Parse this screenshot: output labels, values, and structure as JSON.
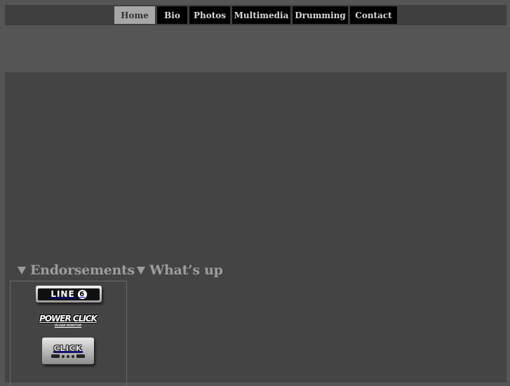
{
  "nav": {
    "items": [
      {
        "label": "Home",
        "active": true
      },
      {
        "label": "Bio"
      },
      {
        "label": "Photos"
      },
      {
        "label": "Multimedia"
      },
      {
        "label": "Drumming"
      },
      {
        "label": "Contact"
      }
    ]
  },
  "sections": {
    "endorsements": "Endorsements",
    "whats_up": "What’s up"
  },
  "logos": {
    "line6_text": "LINE",
    "line6_digit": "6",
    "powerclick_text": "POWER CLICK",
    "powerclick_sub": "IN-EAR MONITOR",
    "clicka_text": "CLICK"
  }
}
